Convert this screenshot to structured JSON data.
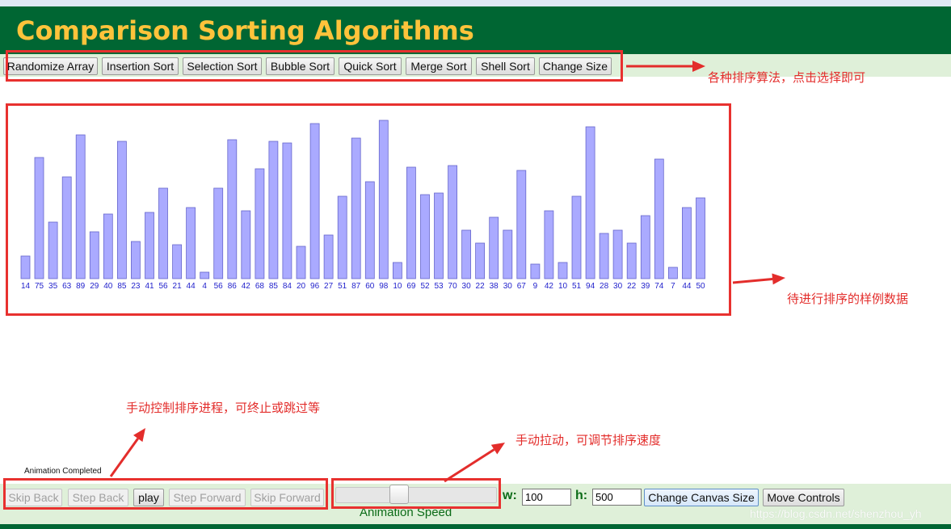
{
  "app": {
    "title": "Comparison Sorting Algorithms"
  },
  "toolbar": {
    "buttons": [
      "Randomize Array",
      "Insertion Sort",
      "Selection Sort",
      "Bubble Sort",
      "Quick Sort",
      "Merge Sort",
      "Shell Sort",
      "Change Size"
    ]
  },
  "chart_data": {
    "type": "bar",
    "categories": [
      "14",
      "75",
      "35",
      "63",
      "89",
      "29",
      "40",
      "85",
      "23",
      "41",
      "56",
      "21",
      "44",
      "4",
      "56",
      "86",
      "42",
      "68",
      "85",
      "84",
      "20",
      "96",
      "27",
      "51",
      "87",
      "60",
      "98",
      "10",
      "69",
      "52",
      "53",
      "70",
      "30",
      "22",
      "38",
      "30",
      "67",
      "9",
      "42",
      "10",
      "51",
      "94",
      "28",
      "30",
      "22",
      "39",
      "74",
      "7",
      "44",
      "50"
    ],
    "values": [
      14,
      75,
      35,
      63,
      89,
      29,
      40,
      85,
      23,
      41,
      56,
      21,
      44,
      4,
      56,
      86,
      42,
      68,
      85,
      84,
      20,
      96,
      27,
      51,
      87,
      60,
      98,
      10,
      69,
      52,
      53,
      70,
      30,
      22,
      38,
      30,
      67,
      9,
      42,
      10,
      51,
      94,
      28,
      30,
      22,
      39,
      74,
      7,
      44,
      50
    ],
    "title": "",
    "xlabel": "",
    "ylabel": "",
    "ylim": [
      0,
      100
    ],
    "bar_fill": "#aaaaff",
    "bar_stroke": "#6666cc",
    "label_color": "#2222cc"
  },
  "annotations": {
    "sort_buttons_note": "各种排序算法，点击选择即可",
    "sample_data_note": "待进行排序的样例数据",
    "playback_note": "手动控制排序进程，可终止或跳过等",
    "speed_note": "手动拉动，可调节排序速度"
  },
  "status": {
    "text": "Animation Completed"
  },
  "controls": {
    "skip_back": "Skip Back",
    "step_back": "Step Back",
    "play": "play",
    "step_forward": "Step Forward",
    "skip_forward": "Skip Forward",
    "speed_label": "Animation Speed",
    "speed_value": 0.38,
    "width_label": "w:",
    "width_value": "100",
    "height_label": "h:",
    "height_value": "500",
    "change_canvas_size": "Change Canvas Size",
    "move_controls": "Move Controls"
  },
  "watermark": "https://blog.csdn.net/shenzhou_yh",
  "colors": {
    "header_bg": "#006633",
    "title": "#fec33b",
    "toolbar_bg": "#dff0d9",
    "annotation_red": "#e32d2b"
  }
}
